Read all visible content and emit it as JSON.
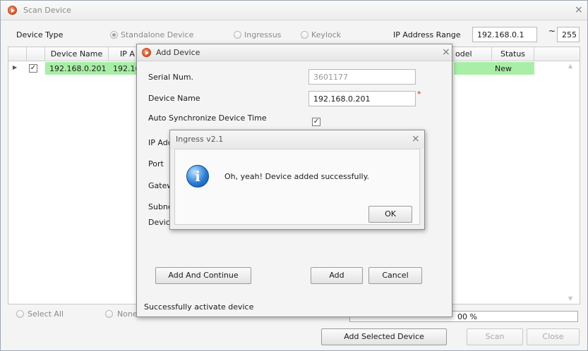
{
  "window": {
    "title": "Scan Device"
  },
  "filters": {
    "device_type_label": "Device Type",
    "options": [
      "Standalone Device",
      "Ingressus",
      "Keylock"
    ],
    "ip_range_label": "IP Address Range",
    "ip_start": "192.168.0.1",
    "tilde": "~",
    "ip_end": "255"
  },
  "grid": {
    "columns": [
      "Device Name",
      "IP A",
      "odel",
      "Status"
    ],
    "row": {
      "device_name": "192.168.0.201",
      "ip": "192.168",
      "status": "New"
    }
  },
  "bottom": {
    "select_all": "Select All",
    "none": "None",
    "progress_text": "00 %",
    "add_selected": "Add Selected Device",
    "scan": "Scan",
    "close": "Close"
  },
  "add_device": {
    "title": "Add Device",
    "serial_label": "Serial Num.",
    "serial_value": "3601177",
    "name_label": "Device Name",
    "name_value": "192.168.0.201",
    "required_mark": "*",
    "auto_sync_label": "Auto Synchronize Device Time",
    "ip_label": "IP Add",
    "port_label": "Port",
    "gateway_label": "Gatew",
    "subnet_label": "Subne",
    "device_label": "Device",
    "add_continue": "Add And Continue",
    "add": "Add",
    "cancel": "Cancel",
    "status": "Successfully activate device"
  },
  "message": {
    "title": "Ingress v2.1",
    "text": "Oh, yeah! Device added successfully.",
    "ok": "OK"
  }
}
